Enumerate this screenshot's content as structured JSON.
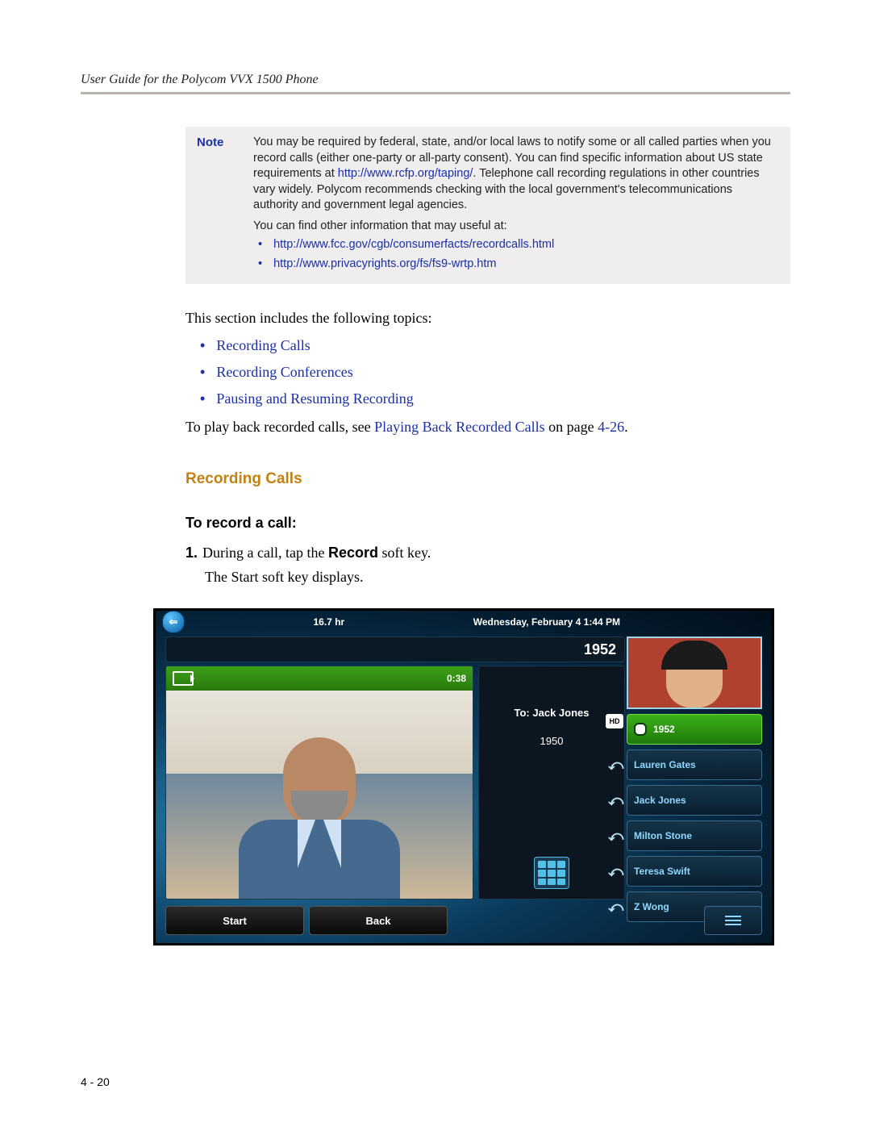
{
  "header": {
    "running": "User Guide for the Polycom VVX 1500 Phone"
  },
  "footer": {
    "page": "4 - 20"
  },
  "note": {
    "label": "Note",
    "body_pre": "You may be required by federal, state, and/or local laws to notify some or all called parties when you record calls (either one-party or all-party consent). You can find specific information about US state requirements at ",
    "body_link1": "http://www.rcfp.org/taping/",
    "body_post": ". Telephone call recording regulations in other countries vary widely. Polycom recommends checking with the local government's telecommunications authority and government legal agencies.",
    "sub": "You can find other information that may useful at:",
    "bullets": [
      "http://www.fcc.gov/cgb/consumerfacts/recordcalls.html",
      "http://www.privacyrights.org/fs/fs9-wrtp.htm"
    ]
  },
  "intro": "This section includes the following topics:",
  "topics": [
    "Recording Calls",
    "Recording Conferences",
    "Pausing and Resuming Recording"
  ],
  "playback": {
    "pre": "To play back recorded calls, see ",
    "link": "Playing Back Recorded Calls",
    "mid": " on page ",
    "ref": "4-26",
    "post": "."
  },
  "h_recording": "Recording Calls",
  "h_task": "To record a call:",
  "step1_num": "1.",
  "step1_a": "During a call, tap the ",
  "step1_b": "Record",
  "step1_c": " soft key.",
  "step1_sub": "The Start soft key displays.",
  "phone": {
    "storage": "16.7 hr",
    "datetime": "Wednesday, February 4  1:44 PM",
    "extension": "1952",
    "call_timer": "0:38",
    "to_label": "To: Jack Jones",
    "to_number": "1950",
    "hd": "HD",
    "line_keys": [
      "1952",
      "Lauren Gates",
      "Jack Jones",
      "Milton Stone",
      "Teresa Swift",
      "Z Wong"
    ],
    "softkeys": {
      "start": "Start",
      "back": "Back"
    }
  }
}
